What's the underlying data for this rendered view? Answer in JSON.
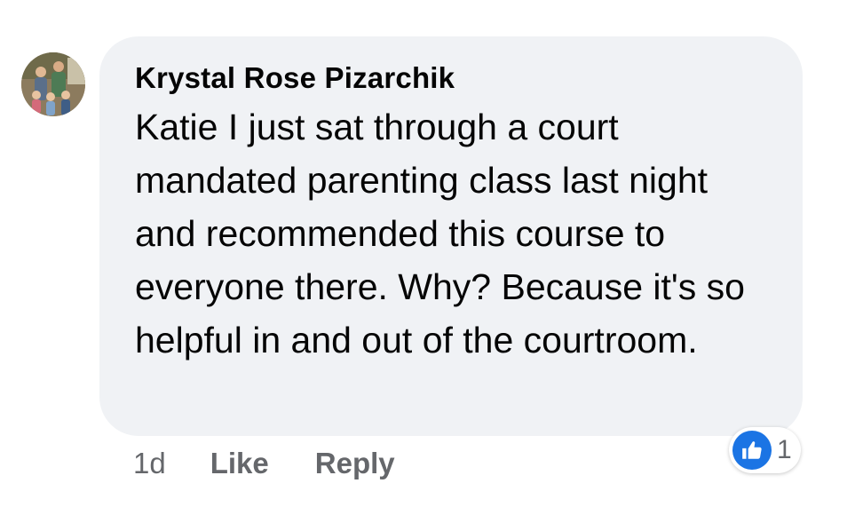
{
  "comment": {
    "author": "Krystal Rose Pizarchik",
    "text": "Katie I just sat through a court mandated parenting class last night and recommended this course to everyone there. Why? Because it's so helpful in and out of the courtroom.",
    "avatar_icon": "family-photo-avatar"
  },
  "actions": {
    "timestamp": "1d",
    "like_label": "Like",
    "reply_label": "Reply"
  },
  "reactions": {
    "icon": "thumbs-up-icon",
    "count": "1",
    "color": "#1b74e4"
  }
}
